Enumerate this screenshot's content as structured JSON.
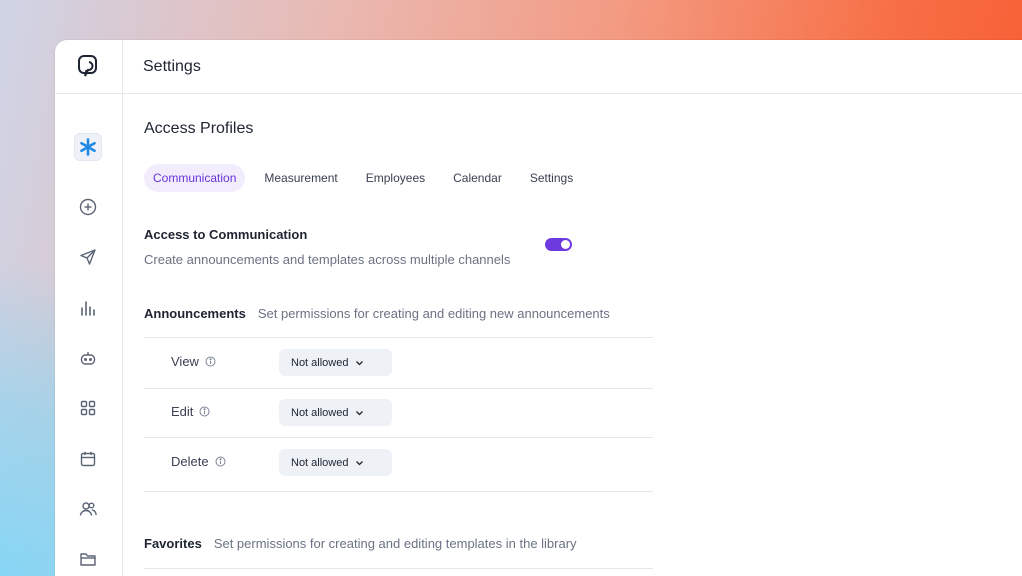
{
  "topbar": {
    "title": "Settings"
  },
  "sidebar": {
    "items": [
      {
        "icon": "asterisk-icon",
        "active": true
      },
      {
        "icon": "plus-circle-icon"
      },
      {
        "icon": "send-icon"
      },
      {
        "icon": "bar-chart-icon"
      },
      {
        "icon": "bot-icon"
      },
      {
        "icon": "grid-icon"
      },
      {
        "icon": "calendar-icon"
      },
      {
        "icon": "users-icon"
      },
      {
        "icon": "folder-icon"
      }
    ]
  },
  "main": {
    "heading": "Access Profiles",
    "tabs": [
      {
        "label": "Communication",
        "active": true
      },
      {
        "label": "Measurement"
      },
      {
        "label": "Employees"
      },
      {
        "label": "Calendar"
      },
      {
        "label": "Settings"
      }
    ],
    "access": {
      "title": "Access to Communication",
      "description": "Create announcements and templates across multiple channels",
      "enabled": true
    },
    "announcements": {
      "title": "Announcements",
      "description": "Set permissions for creating and editing new announcements",
      "rows": [
        {
          "label": "View",
          "value": "Not allowed"
        },
        {
          "label": "Edit",
          "value": "Not allowed"
        },
        {
          "label": "Delete",
          "value": "Not allowed"
        }
      ]
    },
    "favorites": {
      "title": "Favorites",
      "description": "Set permissions for creating and editing templates in the library"
    }
  },
  "colors": {
    "accent": "#6d3ae0",
    "active_tab_bg": "#f1edfd",
    "asterisk": "#1e88e5"
  }
}
